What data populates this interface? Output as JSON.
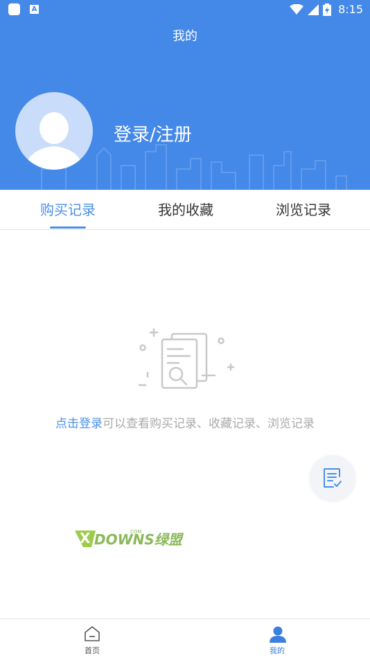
{
  "status_bar": {
    "time": "8:15",
    "app_badge": "A"
  },
  "header": {
    "title": "我的",
    "login_label": "登录/注册"
  },
  "tabs": [
    {
      "label": "购买记录",
      "active": true
    },
    {
      "label": "我的收藏",
      "active": false
    },
    {
      "label": "浏览记录",
      "active": false
    }
  ],
  "empty_state": {
    "link_text": "点击登录",
    "message": "可以查看购买记录、收藏记录、浏览记录"
  },
  "watermark": {
    "text": "DOWNS绿盟",
    "x_text": "X",
    "com": "COM"
  },
  "bottom_nav": [
    {
      "label": "首页",
      "icon": "home-icon",
      "active": false
    },
    {
      "label": "我的",
      "icon": "user-icon",
      "active": true
    }
  ],
  "colors": {
    "primary": "#4488e8",
    "accent_text": "#4a8fe8",
    "muted_text": "#aaaaaa"
  }
}
